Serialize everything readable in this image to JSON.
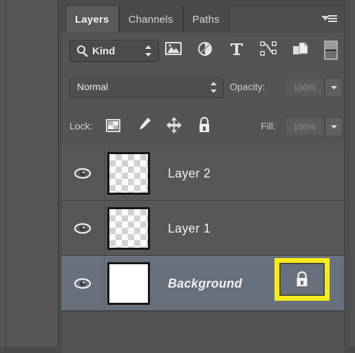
{
  "panel": {
    "title": "Layers",
    "tabs": [
      {
        "label": "Layers",
        "active": true
      },
      {
        "label": "Channels",
        "active": false
      },
      {
        "label": "Paths",
        "active": false
      }
    ],
    "menu_icon": "panel-menu-icon"
  },
  "filter_row": {
    "kind_label": "Kind",
    "search_icon": "magnifier-icon",
    "stepper_icon": "up-down-arrows-icon",
    "type_filters": [
      {
        "name": "filter-pixel-layers",
        "icon": "image-icon"
      },
      {
        "name": "filter-adjustment-layers",
        "icon": "adjustment-circle-icon"
      },
      {
        "name": "filter-type-layers",
        "icon": "type-t-icon"
      },
      {
        "name": "filter-shape-layers",
        "icon": "shape-path-icon"
      },
      {
        "name": "filter-smart-objects",
        "icon": "smart-object-icon"
      }
    ],
    "toggle_icon": "filter-enable-toggle-icon"
  },
  "blend_row": {
    "blend_mode": "Normal",
    "blend_arrows_icon": "up-down-arrows-icon",
    "opacity_label": "Opacity:",
    "opacity_value": "100%",
    "opacity_stepper_icon": "chevron-down-icon"
  },
  "lock_row": {
    "lock_label": "Lock:",
    "lock_buttons": [
      {
        "name": "lock-transparent-pixels",
        "icon": "checkerboard-icon"
      },
      {
        "name": "lock-image-pixels",
        "icon": "paintbrush-icon"
      },
      {
        "name": "lock-position",
        "icon": "move-arrows-icon"
      },
      {
        "name": "lock-all",
        "icon": "padlock-icon"
      }
    ],
    "fill_label": "Fill:",
    "fill_value": "100%",
    "fill_stepper_icon": "chevron-down-icon"
  },
  "layers": [
    {
      "name": "Layer 2",
      "visible": true,
      "selected": false,
      "italic": false,
      "thumbnail": "transparent-checkerboard",
      "locked": false,
      "eye_icon": "eye-visibility-icon"
    },
    {
      "name": "Layer 1",
      "visible": true,
      "selected": false,
      "italic": false,
      "thumbnail": "transparent-checkerboard",
      "locked": false,
      "eye_icon": "eye-visibility-icon"
    },
    {
      "name": "Background",
      "visible": true,
      "selected": true,
      "italic": true,
      "thumbnail": "white-solid",
      "locked": true,
      "eye_icon": "eye-visibility-icon",
      "lock_icon": "padlock-icon"
    }
  ],
  "annotation": {
    "type": "highlight-rectangle",
    "target": "background-layer-lock-icon",
    "color": "#f6ec1c"
  },
  "colors": {
    "panel_bg": "#535353",
    "row_bg": "#575757",
    "selected_row": "#68707e",
    "text": "#f0f0f0",
    "highlight": "#f6ec1c"
  }
}
